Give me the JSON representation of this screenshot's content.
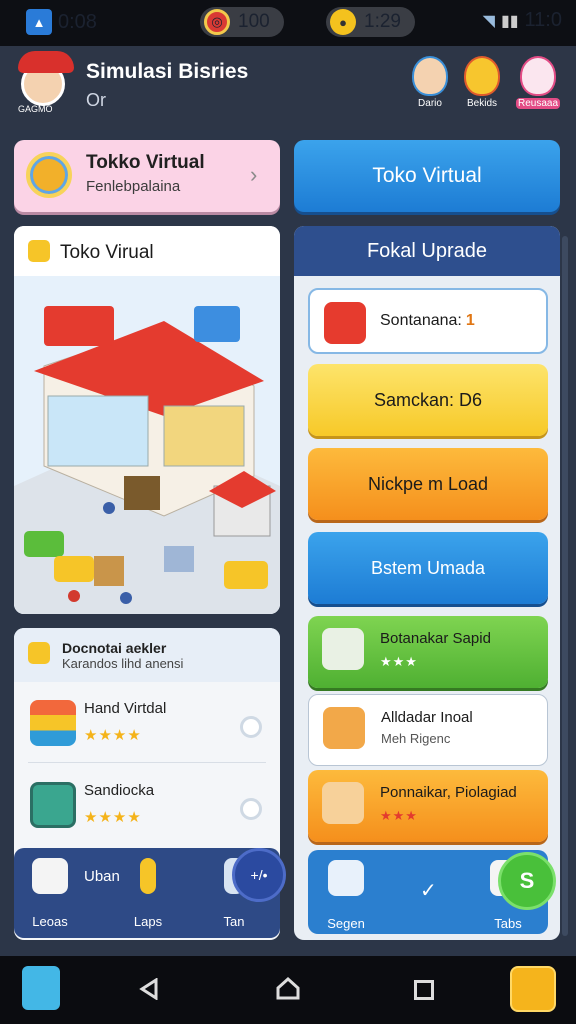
{
  "status_bar": {
    "left_time": "0:08",
    "coins": "100",
    "timer": "1:29",
    "right_time": "11:0"
  },
  "header": {
    "title": "Simulasi Bisries",
    "subtitle": "Or",
    "avatar_badge": "GAGMO",
    "players": [
      {
        "label": "Dario"
      },
      {
        "label": "Bekids"
      },
      {
        "label": "Reusaaa"
      }
    ]
  },
  "top_cards": {
    "pink_title": "Tokko Virtual",
    "pink_sub": "Fenlebpalaina",
    "blue_button": "Toko Virtual"
  },
  "store_card": {
    "title": "Toko Virual"
  },
  "list_card": {
    "title": "Docnotai aekler",
    "subtitle": "Karandos lihd anensi",
    "items": [
      {
        "title": "Hand Virtdal",
        "stars": "★★★★"
      },
      {
        "title": "Sandiocka",
        "stars": "★★★★"
      }
    ],
    "bottom": {
      "inline_label": "Uban",
      "labels": [
        "Leoas",
        "Laps",
        "Tan"
      ],
      "fab": "+/•"
    }
  },
  "upgrade_panel": {
    "title": "Fokal Uprade",
    "items": [
      {
        "label": "Sontanana:",
        "value": "1"
      },
      {
        "label": "Samckan: D6"
      },
      {
        "label": "Nickpe m Load"
      },
      {
        "label": "Bstem Umada"
      },
      {
        "label": "Botanakar Sapid",
        "stars": "★★★"
      },
      {
        "label": "Alldadar Inoal",
        "sub": "Meh Rigenc"
      },
      {
        "label": "Ponnaikar, Piolagiad",
        "stars": "★★★"
      }
    ],
    "bottom": {
      "label_left": "Segen",
      "label_right": "Tabs",
      "fab": "S"
    }
  },
  "colors": {
    "background": "#2c3648",
    "primary_blue": "#1d7cd4",
    "accent_yellow": "#f7c928",
    "accent_orange": "#f58f1c",
    "accent_green": "#4fb032"
  }
}
